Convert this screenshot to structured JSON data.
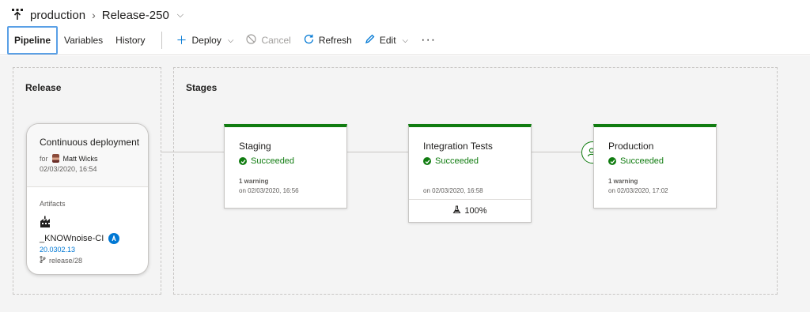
{
  "header": {
    "pipeline_name": "production",
    "release_name": "Release-250"
  },
  "toolbar": {
    "tabs": [
      {
        "label": "Pipeline"
      },
      {
        "label": "Variables"
      },
      {
        "label": "History"
      }
    ],
    "deploy_label": "Deploy",
    "cancel_label": "Cancel",
    "refresh_label": "Refresh",
    "edit_label": "Edit",
    "more_label": "···"
  },
  "release": {
    "section_title": "Release",
    "trigger": "Continuous deployment",
    "for_label": "for",
    "user": "Matt Wicks",
    "date": "02/03/2020, 16:54",
    "artifacts_label": "Artifacts",
    "artifact_name": "_KNOWnoise-CI",
    "artifact_version": "20.0302.13",
    "artifact_branch": "release/28"
  },
  "stages": {
    "section_title": "Stages",
    "items": [
      {
        "name": "Staging",
        "status": "Succeeded",
        "warning": "1 warning",
        "when": "on 02/03/2020, 16:56"
      },
      {
        "name": "Integration Tests",
        "status": "Succeeded",
        "warning": "",
        "when": "on 02/03/2020, 16:58",
        "test_pass": "100%"
      },
      {
        "name": "Production",
        "status": "Succeeded",
        "warning": "1 warning",
        "when": "on 02/03/2020, 17:02"
      }
    ]
  },
  "colors": {
    "success": "#107c10",
    "accent": "#0078d4",
    "canvas": "#f4f4f4"
  },
  "icons": [
    "pipeline-icon",
    "chevron-right-icon",
    "chevron-down-icon",
    "plus-icon",
    "cancel-icon",
    "refresh-icon",
    "edit-icon",
    "more-icon",
    "avatar",
    "build-icon",
    "badge-icon",
    "branch-icon",
    "check-icon",
    "flask-icon",
    "approver-icon"
  ]
}
